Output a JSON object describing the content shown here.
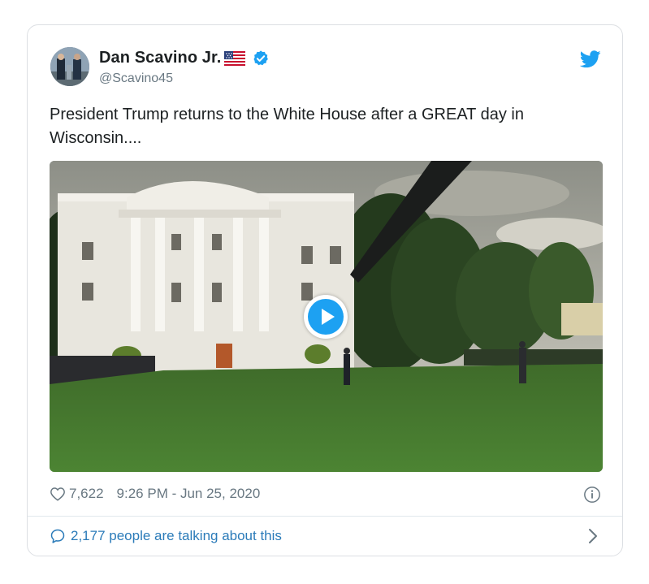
{
  "tweet": {
    "author_name": "Dan Scavino Jr.",
    "author_handle": "@Scavino45",
    "text": "President Trump returns to the White House after a GREAT day in Wisconsin....",
    "likes": "7,622",
    "timestamp": "9:26 PM - Jun 25, 2020",
    "conversation": "2,177 people are talking about this"
  },
  "icons": {
    "verified": "verified-badge-icon",
    "brand": "twitter-bird-icon",
    "flag": "us-flag-icon",
    "like": "heart-icon",
    "info": "info-icon",
    "reply": "speech-bubble-icon",
    "play": "play-icon",
    "chevron": "chevron-right-icon"
  },
  "colors": {
    "brand_blue": "#1da1f2",
    "link_blue": "#2b7bb9",
    "muted_text": "#697882",
    "border": "#dcdfe3"
  }
}
